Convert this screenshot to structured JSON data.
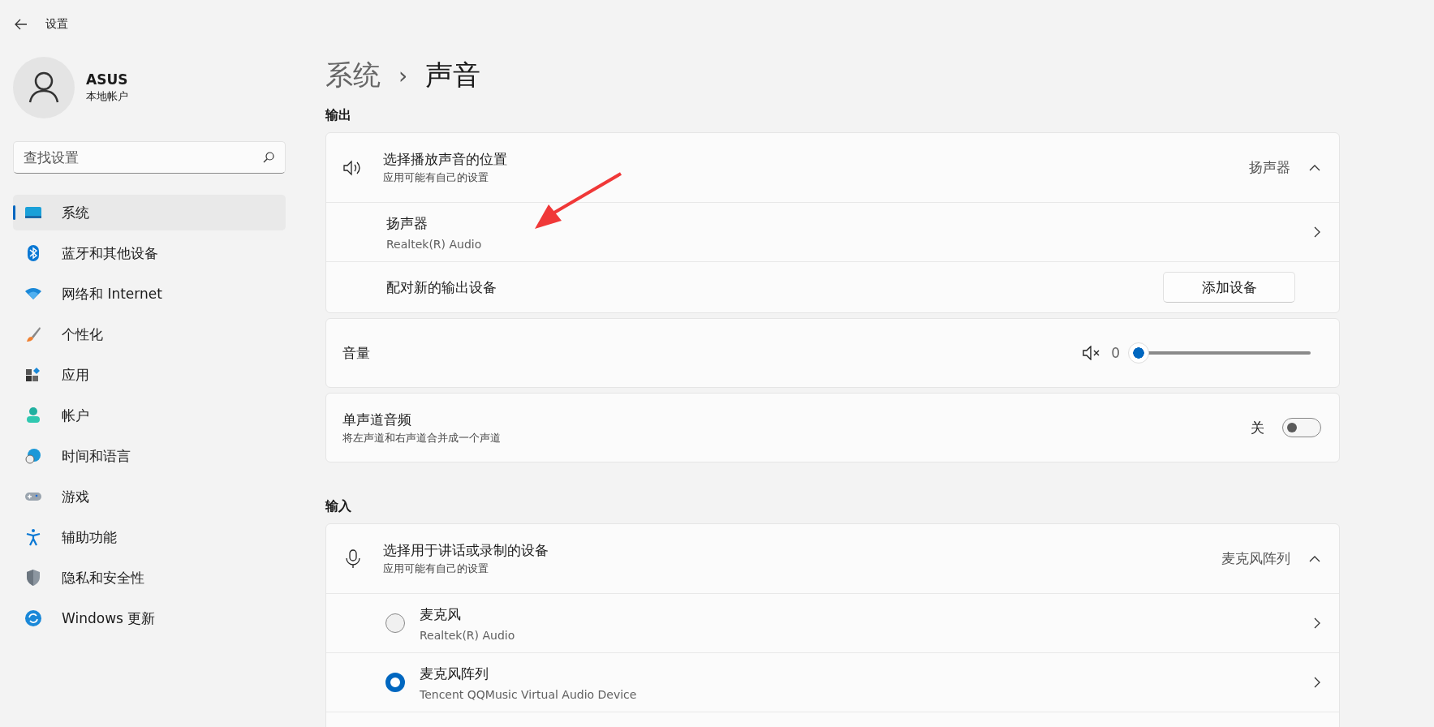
{
  "window": {
    "title": "设置"
  },
  "account": {
    "name": "ASUS",
    "type": "本地帐户"
  },
  "search": {
    "placeholder": "查找设置"
  },
  "sidebar": {
    "items": [
      {
        "label": "系统",
        "selected": true
      },
      {
        "label": "蓝牙和其他设备",
        "selected": false
      },
      {
        "label": "网络和 Internet",
        "selected": false
      },
      {
        "label": "个性化",
        "selected": false
      },
      {
        "label": "应用",
        "selected": false
      },
      {
        "label": "帐户",
        "selected": false
      },
      {
        "label": "时间和语言",
        "selected": false
      },
      {
        "label": "游戏",
        "selected": false
      },
      {
        "label": "辅助功能",
        "selected": false
      },
      {
        "label": "隐私和安全性",
        "selected": false
      },
      {
        "label": "Windows 更新",
        "selected": false
      }
    ]
  },
  "breadcrumb": {
    "parent": "系统",
    "separator": "›",
    "current": "声音"
  },
  "output": {
    "heading": "输出",
    "device_picker": {
      "title": "选择播放声音的位置",
      "subtitle": "应用可能有自己的设置",
      "value": "扬声器",
      "expanded": true
    },
    "devices": [
      {
        "name": "扬声器",
        "detail": "Realtek(R) Audio"
      }
    ],
    "pair": {
      "label": "配对新的输出设备",
      "button": "添加设备"
    },
    "volume": {
      "label": "音量",
      "reading": "0",
      "level": 0,
      "muted": true
    },
    "mono": {
      "title": "单声道音频",
      "subtitle": "将左声道和右声道合并成一个声道",
      "state_label": "关",
      "on": false
    }
  },
  "input": {
    "heading": "输入",
    "device_picker": {
      "title": "选择用于讲话或录制的设备",
      "subtitle": "应用可能有自己的设置",
      "value": "麦克风阵列",
      "expanded": true
    },
    "devices": [
      {
        "name": "麦克风",
        "detail": "Realtek(R) Audio",
        "selected": false
      },
      {
        "name": "麦克风阵列",
        "detail": "Tencent QQMusic Virtual Audio Device",
        "selected": true
      }
    ]
  },
  "annotation": {
    "kind": "arrow"
  }
}
